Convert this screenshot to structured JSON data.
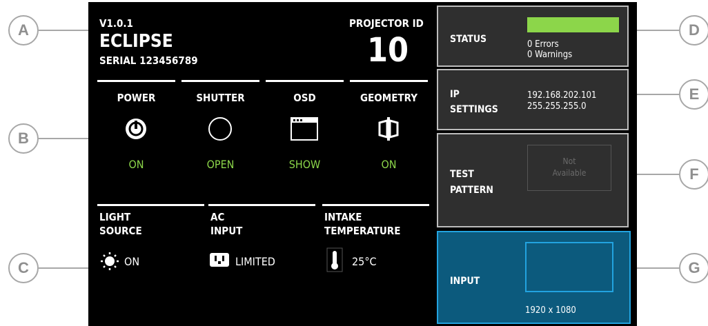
{
  "callouts": {
    "a": "A",
    "b": "B",
    "c": "C",
    "d": "D",
    "e": "E",
    "f": "F",
    "g": "G"
  },
  "header": {
    "version": "V1.0.1",
    "model": "ECLIPSE",
    "serial": "SERIAL 123456789",
    "projector_id_label": "PROJECTOR ID",
    "projector_id": "10"
  },
  "controls": [
    {
      "label": "POWER",
      "icon": "power-icon",
      "state": "ON"
    },
    {
      "label": "SHUTTER",
      "icon": "shutter-circle-icon",
      "state": "OPEN"
    },
    {
      "label": "OSD",
      "icon": "osd-window-icon",
      "state": "SHOW"
    },
    {
      "label": "GEOMETRY",
      "icon": "geometry-icon",
      "state": "ON"
    }
  ],
  "status_items": [
    {
      "label_line1": "LIGHT",
      "label_line2": "SOURCE",
      "icon": "sun-icon",
      "value": "ON"
    },
    {
      "label_line1": "AC",
      "label_line2": "INPUT",
      "icon": "power-outlet-icon",
      "value": "LIMITED"
    },
    {
      "label_line1": "INTAKE",
      "label_line2": "TEMPERATURE",
      "icon": "thermometer-icon",
      "value": "25°C"
    }
  ],
  "status_card": {
    "label": "STATUS",
    "errors": "0 Errors",
    "warnings": "0 Warnings",
    "bar_color": "#8cd64a"
  },
  "ip_card": {
    "label_line1": "IP",
    "label_line2": "SETTINGS",
    "ip": "192.168.202.101",
    "mask": "255.255.255.0"
  },
  "test_pattern_card": {
    "label_line1": "TEST",
    "label_line2": "PATTERN",
    "preview_line1": "Not",
    "preview_line2": "Available"
  },
  "input_card": {
    "label": "INPUT",
    "resolution": "1920 x 1080",
    "accent": "#22a3e0"
  },
  "colors": {
    "screen_bg": "#000000",
    "card_bg": "#2f2f2f",
    "active_green": "#8cd64a",
    "input_bg": "#0c5a7d"
  }
}
